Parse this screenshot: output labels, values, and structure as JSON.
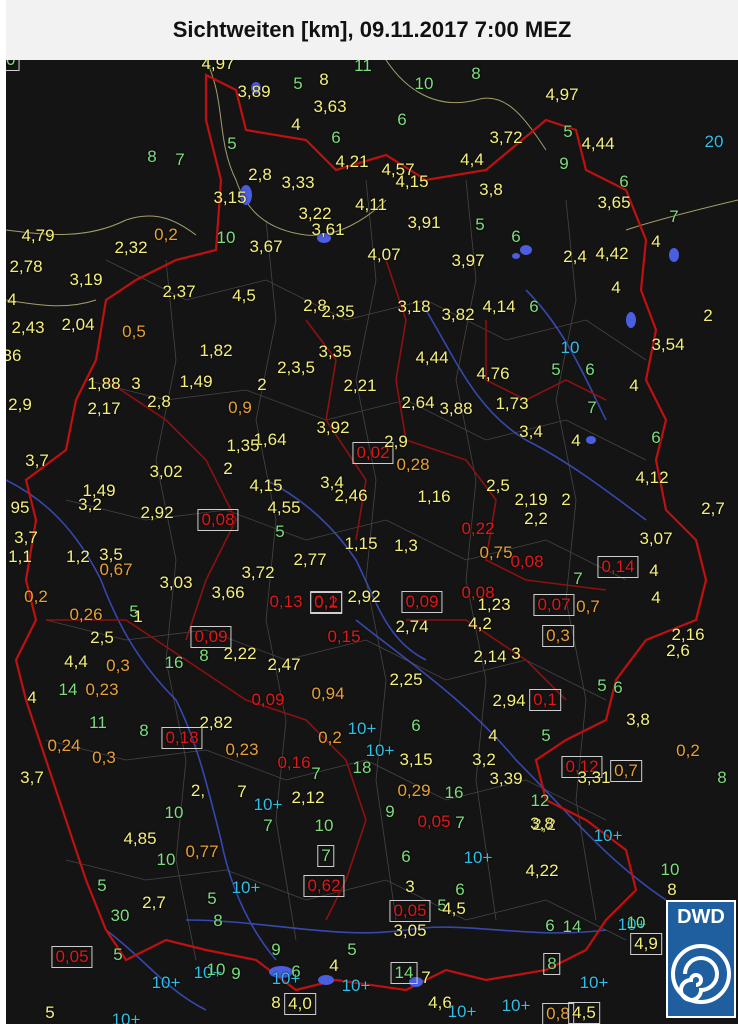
{
  "title": "Sichtweiten [km], 09.11.2017 7:00 MEZ",
  "logo": {
    "text": "DWD"
  },
  "colors": {
    "above_10": "#2fbfe6",
    "5_to_10": "#7ddc7d",
    "1_to_5": "#f5f07a",
    "0.2_to_1": "#e8a030",
    "below_0.2": "#e01818"
  },
  "labels": [
    {
      "text": "4,97",
      "c": "y"
    },
    {
      "text": "3,89",
      "c": "y"
    },
    {
      "text": "5",
      "c": "g"
    },
    {
      "text": "8",
      "c": "y"
    },
    {
      "text": "11",
      "c": "g"
    },
    {
      "text": "10",
      "c": "g"
    },
    {
      "text": "8",
      "c": "g"
    },
    {
      "text": "4,97",
      "c": "y"
    },
    {
      "text": "3,63",
      "c": "y"
    },
    {
      "text": "4",
      "c": "y"
    },
    {
      "text": "6",
      "c": "g"
    },
    {
      "text": "6",
      "c": "g"
    },
    {
      "text": "3,72",
      "c": "y"
    },
    {
      "text": "5",
      "c": "g"
    },
    {
      "text": "4,44",
      "c": "y"
    },
    {
      "text": "20",
      "c": "c"
    },
    {
      "text": "8",
      "c": "g"
    },
    {
      "text": "7",
      "c": "g"
    },
    {
      "text": "5",
      "c": "g"
    },
    {
      "text": "4,21",
      "c": "y"
    },
    {
      "text": "4,57",
      "c": "y"
    },
    {
      "text": "4,4",
      "c": "y"
    },
    {
      "text": "9",
      "c": "g"
    },
    {
      "text": "2,8",
      "c": "y"
    },
    {
      "text": "3,33",
      "c": "y"
    },
    {
      "text": "4,15",
      "c": "y"
    },
    {
      "text": "3,8",
      "c": "y"
    },
    {
      "text": "6",
      "c": "g"
    },
    {
      "text": "3,15",
      "c": "y"
    },
    {
      "text": "4,11",
      "c": "y"
    },
    {
      "text": "3,22",
      "c": "y"
    },
    {
      "text": "3,65",
      "c": "y"
    },
    {
      "text": "7",
      "c": "g"
    },
    {
      "text": "4,79",
      "c": "y"
    },
    {
      "text": "0,2",
      "c": "o"
    },
    {
      "text": "10",
      "c": "g"
    },
    {
      "text": "3,61",
      "c": "y"
    },
    {
      "text": "3,91",
      "c": "y"
    },
    {
      "text": "5",
      "c": "g"
    },
    {
      "text": "6",
      "c": "g"
    },
    {
      "text": "4",
      "c": "y"
    },
    {
      "text": "2,32",
      "c": "y"
    },
    {
      "text": "3,67",
      "c": "y"
    },
    {
      "text": "4,07",
      "c": "y"
    },
    {
      "text": "3,97",
      "c": "y"
    },
    {
      "text": "2,4",
      "c": "y"
    },
    {
      "text": "4,42",
      "c": "y"
    },
    {
      "text": "2,78",
      "c": "y"
    },
    {
      "text": "3,19",
      "c": "y"
    },
    {
      "text": "2,37",
      "c": "y"
    },
    {
      "text": "4,5",
      "c": "y"
    },
    {
      "text": "4",
      "c": "y"
    },
    {
      "text": "4",
      "c": "y"
    },
    {
      "text": "2,8",
      "c": "y"
    },
    {
      "text": "3,18",
      "c": "y"
    },
    {
      "text": "4,14",
      "c": "y"
    },
    {
      "text": "6",
      "c": "g"
    },
    {
      "text": "2,43",
      "c": "y"
    },
    {
      "text": "2,04",
      "c": "y"
    },
    {
      "text": "0,5",
      "c": "o"
    },
    {
      "text": "2,35",
      "c": "y"
    },
    {
      "text": "3,82",
      "c": "y"
    },
    {
      "text": "2",
      "c": "y"
    },
    {
      "text": "36",
      "c": "y"
    },
    {
      "text": "1,82",
      "c": "y"
    },
    {
      "text": "3,35",
      "c": "y"
    },
    {
      "text": "10",
      "c": "c"
    },
    {
      "text": "3,54",
      "c": "y"
    },
    {
      "text": "2,3,5",
      "c": "y"
    },
    {
      "text": "4,44",
      "c": "y"
    },
    {
      "text": "4,76",
      "c": "y"
    },
    {
      "text": "5",
      "c": "g"
    },
    {
      "text": "6",
      "c": "g"
    },
    {
      "text": "1,88",
      "c": "y"
    },
    {
      "text": "3",
      "c": "y"
    },
    {
      "text": "1,49",
      "c": "y"
    },
    {
      "text": "2",
      "c": "y"
    },
    {
      "text": "2,21",
      "c": "y"
    },
    {
      "text": "4",
      "c": "y"
    },
    {
      "text": "2,9",
      "c": "y"
    },
    {
      "text": "2,17",
      "c": "y"
    },
    {
      "text": "2,8",
      "c": "y"
    },
    {
      "text": "0,9",
      "c": "o"
    },
    {
      "text": "2,64",
      "c": "y"
    },
    {
      "text": "3,88",
      "c": "y"
    },
    {
      "text": "1,73",
      "c": "y"
    },
    {
      "text": "7",
      "c": "g"
    },
    {
      "text": "3,92",
      "c": "y"
    },
    {
      "text": "1,64",
      "c": "y"
    },
    {
      "text": "1,35",
      "c": "y"
    },
    {
      "text": "3,4",
      "c": "y"
    },
    {
      "text": "6",
      "c": "g"
    },
    {
      "text": "3,7",
      "c": "y"
    },
    {
      "text": "0,02",
      "c": "r",
      "box": true
    },
    {
      "text": "2,9",
      "c": "y"
    },
    {
      "text": "0,28",
      "c": "o"
    },
    {
      "text": "4",
      "c": "y"
    },
    {
      "text": "3,02",
      "c": "y"
    },
    {
      "text": "2",
      "c": "y"
    },
    {
      "text": "4,12",
      "c": "y"
    },
    {
      "text": "1,49",
      "c": "y"
    },
    {
      "text": "3,4",
      "c": "y"
    },
    {
      "text": "4,15",
      "c": "y"
    },
    {
      "text": "2,46",
      "c": "y"
    },
    {
      "text": "1,16",
      "c": "y"
    },
    {
      "text": "2,5",
      "c": "y"
    },
    {
      "text": "2,19",
      "c": "y"
    },
    {
      "text": "2",
      "c": "y"
    },
    {
      "text": "95",
      "c": "y"
    },
    {
      "text": "3,2",
      "c": "y"
    },
    {
      "text": "2,92",
      "c": "y"
    },
    {
      "text": "0,08",
      "c": "r",
      "box": true
    },
    {
      "text": "4,55",
      "c": "y"
    },
    {
      "text": "2,7",
      "c": "y"
    },
    {
      "text": "5",
      "c": "g"
    },
    {
      "text": "0,22",
      "c": "r"
    },
    {
      "text": "2,2",
      "c": "y"
    },
    {
      "text": "3,7",
      "c": "y"
    },
    {
      "text": "1,15",
      "c": "y"
    },
    {
      "text": "1,3",
      "c": "y"
    },
    {
      "text": "0,75",
      "c": "o"
    },
    {
      "text": "3,07",
      "c": "y"
    },
    {
      "text": "1,1",
      "c": "y"
    },
    {
      "text": "1,2",
      "c": "y"
    },
    {
      "text": "3,5",
      "c": "y"
    },
    {
      "text": "2,77",
      "c": "y"
    },
    {
      "text": "0,08",
      "c": "r"
    },
    {
      "text": "0,14",
      "c": "r",
      "box": true
    },
    {
      "text": "4",
      "c": "y"
    },
    {
      "text": "0,67",
      "c": "o"
    },
    {
      "text": "3,03",
      "c": "y"
    },
    {
      "text": "3,72",
      "c": "y"
    },
    {
      "text": "0,2",
      "c": "r",
      "box": true
    },
    {
      "text": "2,92",
      "c": "y"
    },
    {
      "text": "0,08",
      "c": "r"
    },
    {
      "text": "7",
      "c": "g"
    },
    {
      "text": "0,2",
      "c": "o"
    },
    {
      "text": "3,66",
      "c": "y"
    },
    {
      "text": "0,13",
      "c": "r"
    },
    {
      "text": "0,1",
      "c": "r",
      "box": true
    },
    {
      "text": "0,09",
      "c": "r",
      "box": true
    },
    {
      "text": "1,23",
      "c": "y"
    },
    {
      "text": "0,07",
      "c": "r",
      "box": true
    },
    {
      "text": "0,7",
      "c": "o"
    },
    {
      "text": "4",
      "c": "y"
    },
    {
      "text": "0,26",
      "c": "o"
    },
    {
      "text": "5",
      "c": "g"
    },
    {
      "text": "1",
      "c": "y"
    },
    {
      "text": "2,74",
      "c": "y"
    },
    {
      "text": "4,2",
      "c": "y"
    },
    {
      "text": "2,5",
      "c": "y"
    },
    {
      "text": "0,09",
      "c": "r",
      "box": true
    },
    {
      "text": "0,15",
      "c": "r"
    },
    {
      "text": "0,3",
      "c": "o",
      "box": true
    },
    {
      "text": "2,16",
      "c": "y"
    },
    {
      "text": "4,4",
      "c": "y"
    },
    {
      "text": "0,3",
      "c": "o"
    },
    {
      "text": "16",
      "c": "g"
    },
    {
      "text": "8",
      "c": "g"
    },
    {
      "text": "2,22",
      "c": "y"
    },
    {
      "text": "2,47",
      "c": "y"
    },
    {
      "text": "2,14",
      "c": "y"
    },
    {
      "text": "3",
      "c": "y"
    },
    {
      "text": "2,6",
      "c": "y"
    },
    {
      "text": "14",
      "c": "g"
    },
    {
      "text": "0,23",
      "c": "o"
    },
    {
      "text": "2,25",
      "c": "y"
    },
    {
      "text": "6",
      "c": "g"
    },
    {
      "text": "4",
      "c": "y"
    },
    {
      "text": "0,09",
      "c": "r"
    },
    {
      "text": "0,94",
      "c": "o"
    },
    {
      "text": "2,94",
      "c": "y"
    },
    {
      "text": "0,1",
      "c": "r",
      "box": true
    },
    {
      "text": "5",
      "c": "g"
    },
    {
      "text": "11",
      "c": "g"
    },
    {
      "text": "2,82",
      "c": "y"
    },
    {
      "text": "10+",
      "c": "c"
    },
    {
      "text": "6",
      "c": "g"
    },
    {
      "text": "3,8",
      "c": "y"
    },
    {
      "text": "8",
      "c": "g"
    },
    {
      "text": "0,18",
      "c": "r",
      "box": true
    },
    {
      "text": "0,2",
      "c": "o"
    },
    {
      "text": "4",
      "c": "y"
    },
    {
      "text": "5",
      "c": "g"
    },
    {
      "text": "0,24",
      "c": "o"
    },
    {
      "text": "0,3",
      "c": "o"
    },
    {
      "text": "0,23",
      "c": "o"
    },
    {
      "text": "10+",
      "c": "c"
    },
    {
      "text": "0,2",
      "c": "o"
    },
    {
      "text": "3,15",
      "c": "y"
    },
    {
      "text": "3,2",
      "c": "y"
    },
    {
      "text": "0,12",
      "c": "r",
      "box": true
    },
    {
      "text": "0,7",
      "c": "o",
      "box": true
    },
    {
      "text": "3,7",
      "c": "y"
    },
    {
      "text": "0,16",
      "c": "r"
    },
    {
      "text": "7",
      "c": "g"
    },
    {
      "text": "18",
      "c": "g"
    },
    {
      "text": "3,39",
      "c": "y"
    },
    {
      "text": "3,31",
      "c": "y"
    },
    {
      "text": "8",
      "c": "g"
    },
    {
      "text": "2,",
      "c": "y"
    },
    {
      "text": "7",
      "c": "y"
    },
    {
      "text": "2,12",
      "c": "y"
    },
    {
      "text": "0,29",
      "c": "o"
    },
    {
      "text": "16",
      "c": "g"
    },
    {
      "text": "4,85",
      "c": "y"
    },
    {
      "text": "10+",
      "c": "c"
    },
    {
      "text": "9",
      "c": "g"
    },
    {
      "text": "12",
      "c": "g"
    },
    {
      "text": "2,2",
      "c": "y"
    },
    {
      "text": "10",
      "c": "g"
    },
    {
      "text": "7",
      "c": "g"
    },
    {
      "text": "10",
      "c": "g"
    },
    {
      "text": "0,05",
      "c": "r"
    },
    {
      "text": "7",
      "c": "g"
    },
    {
      "text": "3,8",
      "c": "y"
    },
    {
      "text": "10",
      "c": "g"
    },
    {
      "text": "10+",
      "c": "c"
    },
    {
      "text": "0,77",
      "c": "o"
    },
    {
      "text": "7",
      "c": "g",
      "box": true
    },
    {
      "text": "6",
      "c": "g"
    },
    {
      "text": "10+",
      "c": "c"
    },
    {
      "text": "4,22",
      "c": "y"
    },
    {
      "text": "5",
      "c": "g"
    },
    {
      "text": "10+",
      "c": "c"
    },
    {
      "text": "0,62",
      "c": "r",
      "box": true
    },
    {
      "text": "3",
      "c": "y"
    },
    {
      "text": "6",
      "c": "g"
    },
    {
      "text": "10",
      "c": "g"
    },
    {
      "text": "8",
      "c": "y"
    },
    {
      "text": "30",
      "c": "g"
    },
    {
      "text": "2,7",
      "c": "y"
    },
    {
      "text": "8",
      "c": "g"
    },
    {
      "text": "0,05",
      "c": "r",
      "box": true
    },
    {
      "text": "5",
      "c": "g"
    },
    {
      "text": "4,5",
      "c": "y"
    },
    {
      "text": "6",
      "c": "g"
    },
    {
      "text": "14",
      "c": "g"
    },
    {
      "text": "10+",
      "c": "c"
    },
    {
      "text": "10",
      "c": "g"
    },
    {
      "text": "0,05",
      "c": "r",
      "box": true
    },
    {
      "text": "5",
      "c": "g"
    },
    {
      "text": "5",
      "c": "g"
    },
    {
      "text": "3,05",
      "c": "y"
    },
    {
      "text": "4,9",
      "c": "y",
      "box": true
    },
    {
      "text": "5",
      "c": "g"
    },
    {
      "text": "10+",
      "c": "c"
    },
    {
      "text": "9",
      "c": "g"
    },
    {
      "text": "4",
      "c": "y"
    },
    {
      "text": "6",
      "c": "g"
    },
    {
      "text": "10+",
      "c": "c"
    },
    {
      "text": "10",
      "c": "g"
    },
    {
      "text": "9",
      "c": "g"
    },
    {
      "text": "10+",
      "c": "c"
    },
    {
      "text": "10+",
      "c": "c"
    },
    {
      "text": "14",
      "c": "g",
      "box": true
    },
    {
      "text": "7",
      "c": "y"
    },
    {
      "text": "8",
      "c": "g",
      "box": true
    },
    {
      "text": "10+",
      "c": "c"
    },
    {
      "text": "5",
      "c": "y"
    },
    {
      "text": "10+",
      "c": "c"
    },
    {
      "text": "8",
      "c": "y"
    },
    {
      "text": "4,0",
      "c": "y",
      "box": true
    },
    {
      "text": "4,6",
      "c": "y"
    },
    {
      "text": "10+",
      "c": "c"
    },
    {
      "text": "10+",
      "c": "c"
    },
    {
      "text": "0,8",
      "c": "o",
      "box": true
    },
    {
      "text": "4,5",
      "c": "y",
      "box": true
    },
    {
      "text": "10",
      "c": "g",
      "box": true
    }
  ]
}
